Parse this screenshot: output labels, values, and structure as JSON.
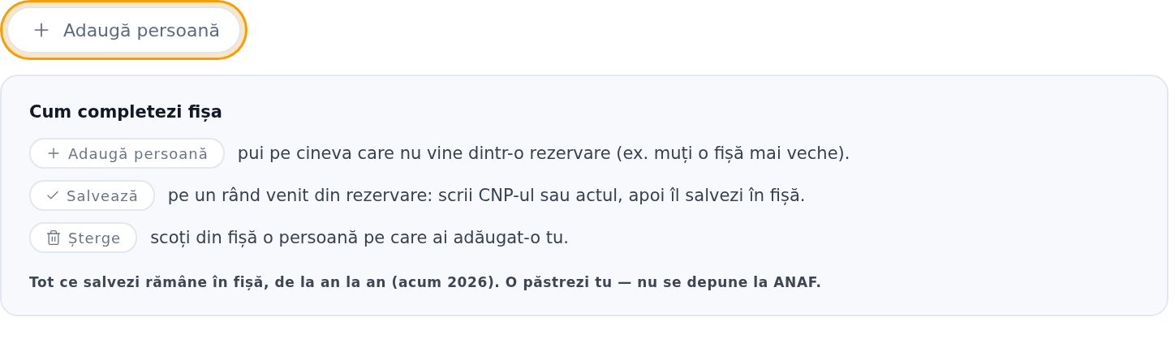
{
  "add_button": {
    "label": "Adaugă persoană",
    "focused": true
  },
  "help": {
    "title": "Cum completezi fișa",
    "rows": [
      {
        "kind": "add",
        "chip": "Adaugă persoană",
        "text": "pui pe cineva care nu vine dintr-o rezervare (ex. muți o fișă mai veche)."
      },
      {
        "kind": "save",
        "chip": "Salvează",
        "text": "pe un rând venit din rezervare: scrii CNP-ul sau actul, apoi îl salvezi în fișă."
      },
      {
        "kind": "delete",
        "chip": "Șterge",
        "text": "scoți din fișă o persoană pe care ai adăugat-o tu."
      }
    ],
    "note": "Tot ce salvezi rămâne în fișă, de la an la an (acum 2026). O păstrezi tu — nu se depune la ANAF."
  }
}
